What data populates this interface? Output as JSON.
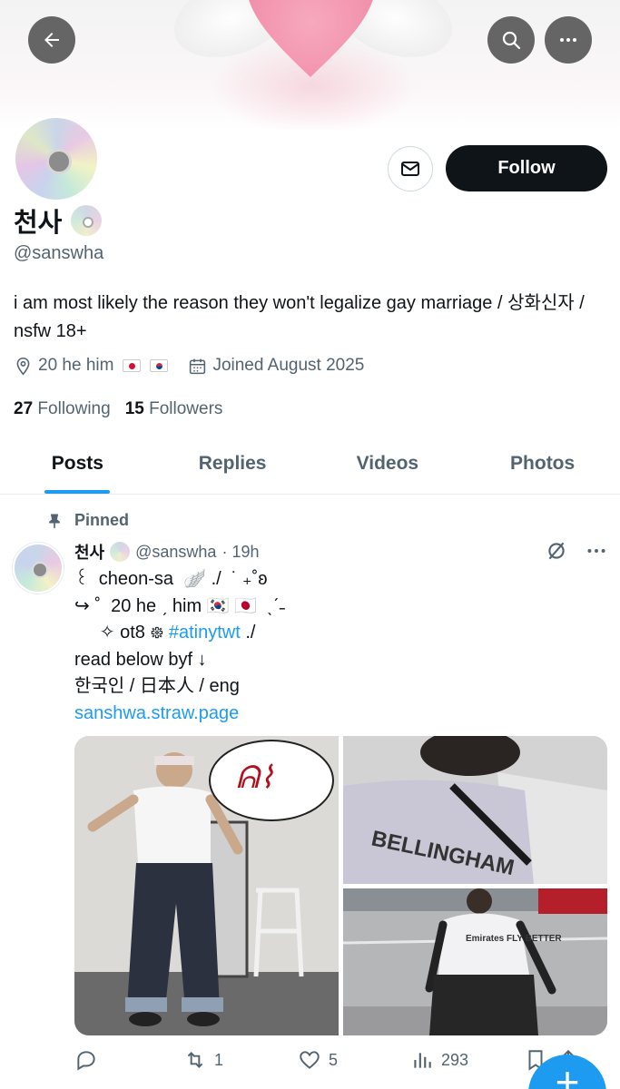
{
  "header": {
    "back_icon": "arrow-left-icon",
    "search_icon": "search-icon",
    "more_icon": "more-horizontal-icon"
  },
  "profile": {
    "display_name": "천사",
    "handle": "@sanswha",
    "follow_label": "Follow",
    "bio": "i am most likely the reason they won't legalize gay marriage / 상화신자 / nsfw 18+",
    "location": "20 he him",
    "joined": "Joined August 2025",
    "following_count": "27",
    "following_label": "Following",
    "followers_count": "15",
    "followers_label": "Followers"
  },
  "tabs": [
    "Posts",
    "Replies",
    "Videos",
    "Photos"
  ],
  "tweet": {
    "pinned_label": "Pinned",
    "name": "천사",
    "handle": "@sanswha",
    "time": "· 19h",
    "lines": [
      "꒰  cheon-sa  🪽 ./  ˙ ₊˚ʚ",
      "↪ ˚  20 he ˏ him 🇰🇷 🇯🇵  ˎˊ˗",
      "     ✧ ot8 ᪥"
    ],
    "hashtag": "#atinytwt",
    "hashtag_suffix": " ./",
    "line4": "read below byf ↓",
    "line5": "한국인 / 日本人 / eng",
    "link": "sanshwa.straw.page",
    "bubble_text": "ᕱ⌇",
    "jersey_text": "BELLINGHAM",
    "shirt_text": "Emirates FLY BETTER",
    "retweets": "1",
    "likes": "5",
    "views": "293"
  },
  "colors": {
    "accent": "#1d9bf0",
    "text": "#0f1419",
    "muted": "#536471"
  }
}
